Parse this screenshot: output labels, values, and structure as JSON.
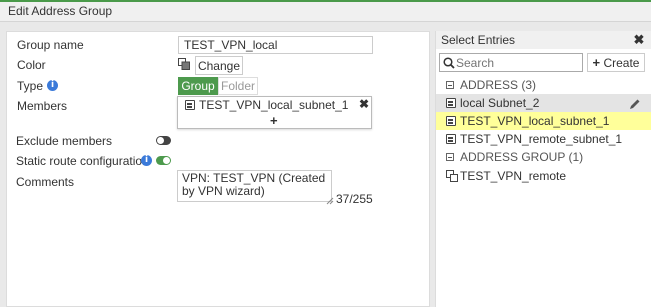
{
  "header": {
    "title": "Edit Address Group"
  },
  "form": {
    "group_name_label": "Group name",
    "group_name_value": "TEST_VPN_local",
    "color_label": "Color",
    "color_change_label": "Change",
    "type_label": "Type",
    "type_options": [
      "Group",
      "Folder"
    ],
    "type_selected": "Group",
    "members_label": "Members",
    "members": [
      {
        "name": "TEST_VPN_local_subnet_1"
      }
    ],
    "add_member_label": "+",
    "exclude_label": "Exclude members",
    "exclude_enabled": false,
    "static_route_label": "Static route configuration",
    "static_route_enabled": true,
    "comments_label": "Comments",
    "comments_value": "VPN: TEST_VPN (Created by VPN wizard)",
    "comments_counter": "37/255"
  },
  "panel": {
    "title": "Select Entries",
    "search_placeholder": "Search",
    "create_label": "Create",
    "groups": [
      {
        "label": "ADDRESS (3)",
        "items": [
          {
            "name": "local Subnet_2",
            "icon": "address-icon",
            "state": "hover"
          },
          {
            "name": "TEST_VPN_local_subnet_1",
            "icon": "address-icon",
            "state": "selected"
          },
          {
            "name": "TEST_VPN_remote_subnet_1",
            "icon": "address-icon",
            "state": "normal"
          }
        ]
      },
      {
        "label": "ADDRESS GROUP (1)",
        "items": [
          {
            "name": "TEST_VPN_remote",
            "icon": "address-group-icon",
            "state": "normal"
          }
        ]
      }
    ]
  },
  "colors": {
    "accent_green": "#4d9a4d",
    "selected_row": "#ffff9a",
    "hover_row": "#e4e4e4",
    "info_blue": "#3b7ad9"
  }
}
